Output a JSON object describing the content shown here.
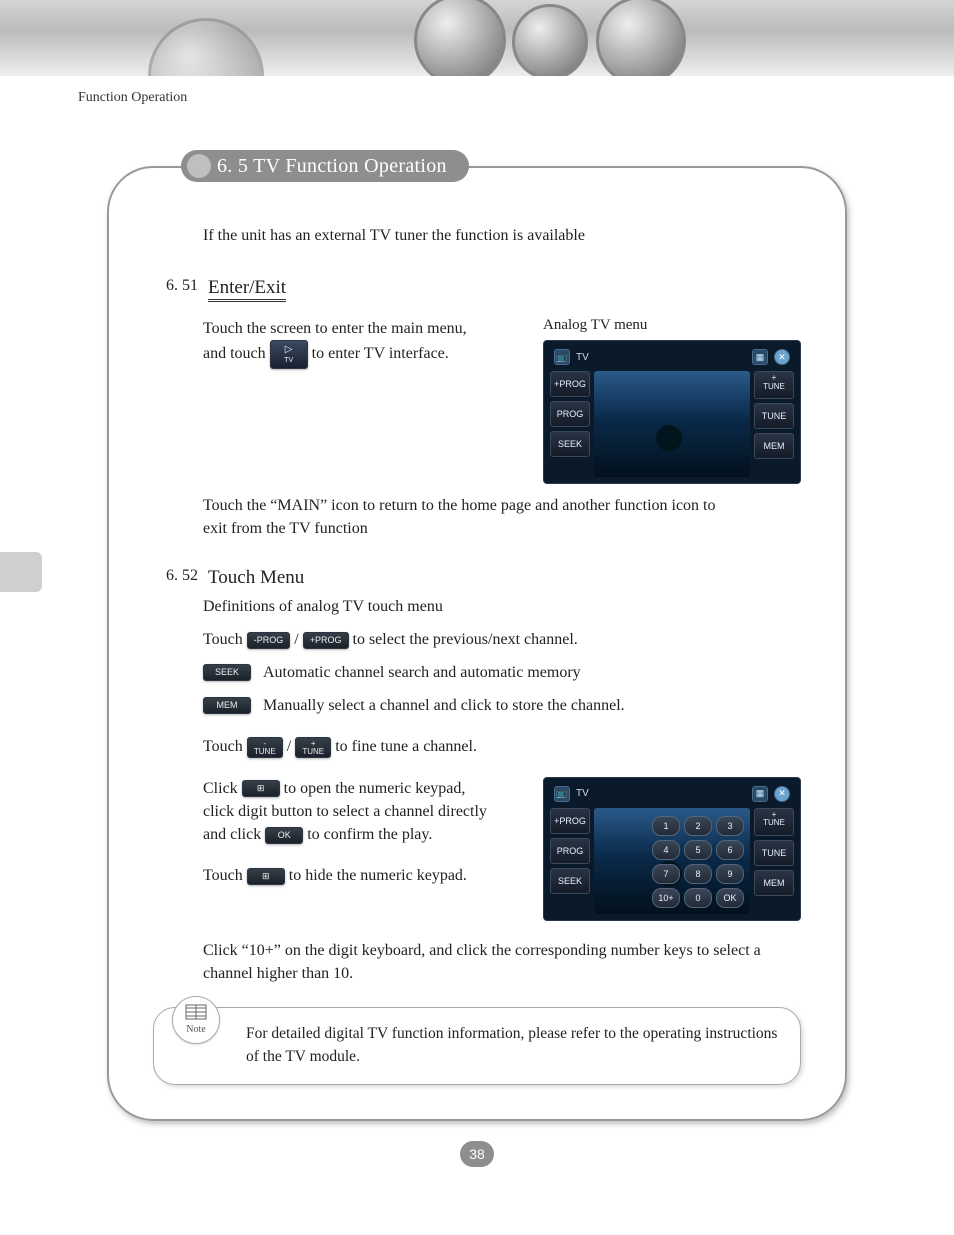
{
  "runningHead": "Function Operation",
  "sectionTitle": "6. 5 TV Function Operation",
  "intro": "If the unit has an external TV tuner the function is available",
  "sec651": {
    "num": "6. 51",
    "head": "Enter/Exit",
    "para1a": "Touch the screen to enter the main menu, and touch",
    "tvIconLabel": "TV",
    "para1b": "to enter TV interface.",
    "tvMenuLabel": "Analog TV menu",
    "para2": "Touch the “MAIN” icon to return to the home page and another function icon to exit from the TV function"
  },
  "tvScreen": {
    "title": "TV",
    "leftButtons": [
      "+PROG",
      "PROG",
      "SEEK"
    ],
    "rightButtons": [
      "+\nTUNE",
      "TUNE",
      "MEM"
    ],
    "keypad": [
      "1",
      "2",
      "3",
      "4",
      "5",
      "6",
      "7",
      "8",
      "9",
      "10+",
      "0",
      "OK"
    ]
  },
  "sec652": {
    "num": "6. 52",
    "head": "Touch Menu",
    "def": "Definitions of analog TV touch menu",
    "touchWord": "Touch",
    "clickWord": "Click",
    "slash": " / ",
    "progMinus": "-PROG",
    "progPlus": "+PROG",
    "progText": " to select the previous/next channel.",
    "seek": "SEEK",
    "seekText": "Automatic channel search and automatic memory",
    "mem": "MEM",
    "memText": "Manually select a channel and  click to store the channel.",
    "tuneMinus": "TUNE",
    "tunePlus": "+\nTUNE",
    "tuneText": " to fine tune a channel.",
    "keypadIcon": "⯚",
    "keypadOpen": " to open the numeric keypad, click digit button to select a channel directly and click ",
    "ok": "OK",
    "confirm": " to confirm the play.",
    "hideKeypad": " to hide the numeric  keypad.",
    "tenPlus": "Click “10+” on the digit  keyboard, and click the corresponding number  keys to select a channel higher than 10."
  },
  "note": {
    "label": "Note",
    "text": "For detailed  digital TV function information, please refer to the operating instructions of the TV module."
  },
  "pageNumber": "38"
}
